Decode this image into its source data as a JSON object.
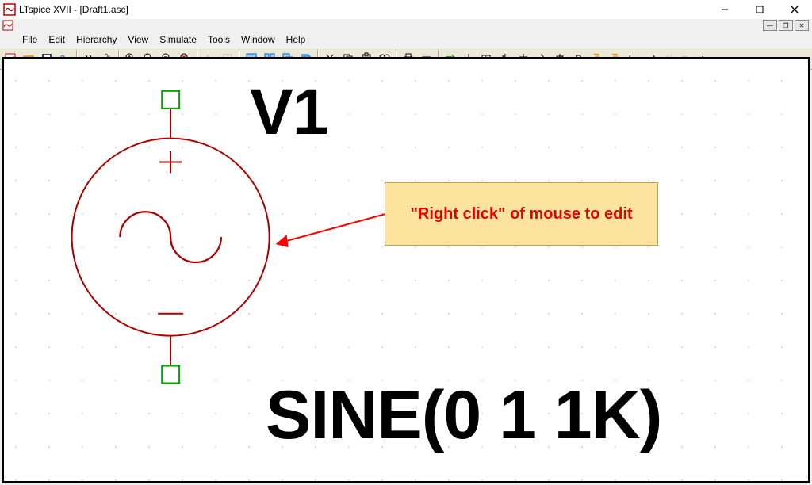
{
  "window": {
    "title": "LTspice XVII - [Draft1.asc]"
  },
  "menu": {
    "file": "File",
    "edit": "Edit",
    "hierarchy": "Hierarchy",
    "view": "View",
    "simulate": "Simulate",
    "tools": "Tools",
    "window": "Window",
    "help": "Help"
  },
  "labels": {
    "component_name": "V1",
    "component_value": "SINE(0 1 1K)"
  },
  "callout": {
    "text": "\"Right click\" of mouse to edit"
  },
  "component": {
    "type": "voltage_source",
    "refdes": "V1",
    "value": "SINE(0 1 1K)"
  }
}
